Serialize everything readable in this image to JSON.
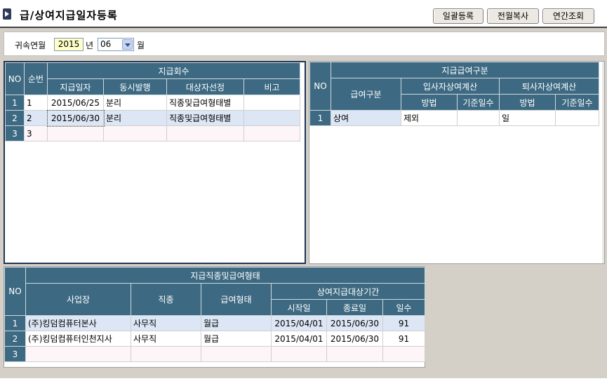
{
  "title": "급/상여지급일자등록",
  "toolbar": {
    "batch_label": "일괄등록",
    "copy_label": "전월복사",
    "annual_label": "연간조회"
  },
  "filter": {
    "label": "귀속연월",
    "year": "2015",
    "year_unit": "년",
    "month": "06",
    "month_unit": "월"
  },
  "pay_rounds": {
    "group_header": "지급회수",
    "headers": {
      "no": "NO",
      "seq": "순번",
      "date": "지급일자",
      "simul": "동시발행",
      "target": "대상자선정",
      "note": "비고"
    },
    "rows": [
      {
        "no": "1",
        "seq": "1",
        "date": "2015/06/25",
        "simul": "분리",
        "target": "직종및급여형태별",
        "note": ""
      },
      {
        "no": "2",
        "seq": "2",
        "date": "2015/06/30",
        "simul": "분리",
        "target": "직종및급여형태별",
        "note": ""
      },
      {
        "no": "3",
        "seq": "3",
        "date": "",
        "simul": "",
        "target": "",
        "note": ""
      }
    ]
  },
  "pay_type": {
    "group_header": "지급급여구분",
    "headers": {
      "no": "NO",
      "type": "급여구분",
      "entrant": "입사자상여계산",
      "leaver": "퇴사자상여계산",
      "method": "방법",
      "base_days": "기준일수"
    },
    "rows": [
      {
        "no": "1",
        "type": "상여",
        "entrant_method": "제외",
        "entrant_days": "",
        "leaver_method": "일",
        "leaver_days": ""
      }
    ]
  },
  "job_pay": {
    "group_header": "지급직종및급여형태",
    "headers": {
      "no": "NO",
      "site": "사업장",
      "job": "직종",
      "pay_form": "급여형태",
      "period": "상여지급대상기간",
      "start": "시작일",
      "end": "종료일",
      "days": "일수"
    },
    "rows": [
      {
        "no": "1",
        "site": "(주)킹덤컴퓨터본사",
        "job": "사무직",
        "pay_form": "월급",
        "start": "2015/04/01",
        "end": "2015/06/30",
        "days": "91"
      },
      {
        "no": "2",
        "site": "(주)킹덤컴퓨터인천지사",
        "job": "사무직",
        "pay_form": "월급",
        "start": "2015/04/01",
        "end": "2015/06/30",
        "days": "91"
      },
      {
        "no": "3",
        "site": "",
        "job": "",
        "pay_form": "",
        "start": "",
        "end": "",
        "days": ""
      }
    ]
  }
}
